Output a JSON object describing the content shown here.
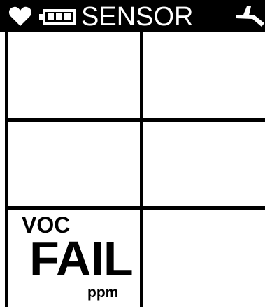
{
  "header": {
    "title": "SENSOR",
    "icons": [
      "heart-icon",
      "battery-icon",
      "pump-icon"
    ],
    "background": "#000000",
    "foreground": "#ffffff"
  },
  "cells": [
    {
      "name": "",
      "value": "",
      "unit": ""
    },
    {
      "name": "",
      "value": "",
      "unit": ""
    },
    {
      "name": "",
      "value": "",
      "unit": ""
    },
    {
      "name": "",
      "value": "",
      "unit": ""
    },
    {
      "name": "VOC",
      "value": "FAIL",
      "unit": "ppm"
    },
    {
      "name": "",
      "value": "",
      "unit": ""
    }
  ],
  "colors": {
    "background": "#ffffff",
    "lines": "#000000",
    "text": "#000000"
  }
}
